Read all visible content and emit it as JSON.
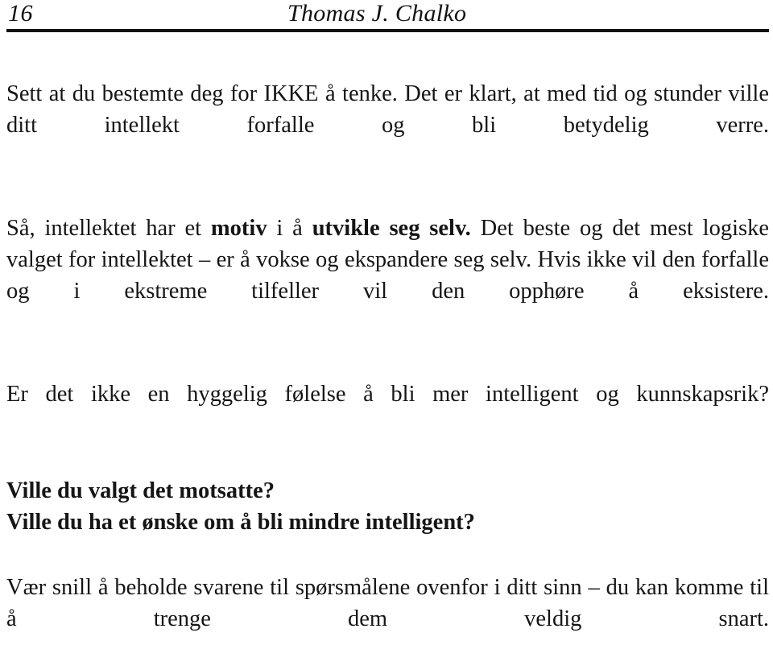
{
  "page": {
    "background_color": "#ffffff",
    "text_color": "#151515"
  },
  "header": {
    "folio": "16",
    "running_title": "Thomas J. Chalko",
    "rule_color": "#111111"
  },
  "body": {
    "paragraph_1": "Sett at du bestemte deg for IKKE å tenke. Det er klart, at med tid og stunder ville ditt intellekt forfalle og bli betydelig verre.",
    "paragraph_2": {
      "run_1": "Så, intellektet har et ",
      "run_2_bold": "motiv",
      "run_3": " i å ",
      "run_4_bold": "utvikle seg selv.",
      "run_5": " Det beste og det mest logiske valget for intellektet – er å vokse og ekspandere seg selv. Hvis ikke vil den forfalle og i ekstreme tilfeller vil den opphøre å eksistere."
    },
    "paragraph_3": "Er det ikke en hyggelig følelse å bli mer intelligent og kunnskapsrik?",
    "bold_line_1": "Ville du valgt det motsatte?",
    "bold_line_2": "Ville du ha et ønske om å bli mindre intelligent?",
    "paragraph_4": "Vær snill å beholde svarene til spørsmålene ovenfor i ditt sinn – du kan komme til å trenge dem veldig snart."
  }
}
